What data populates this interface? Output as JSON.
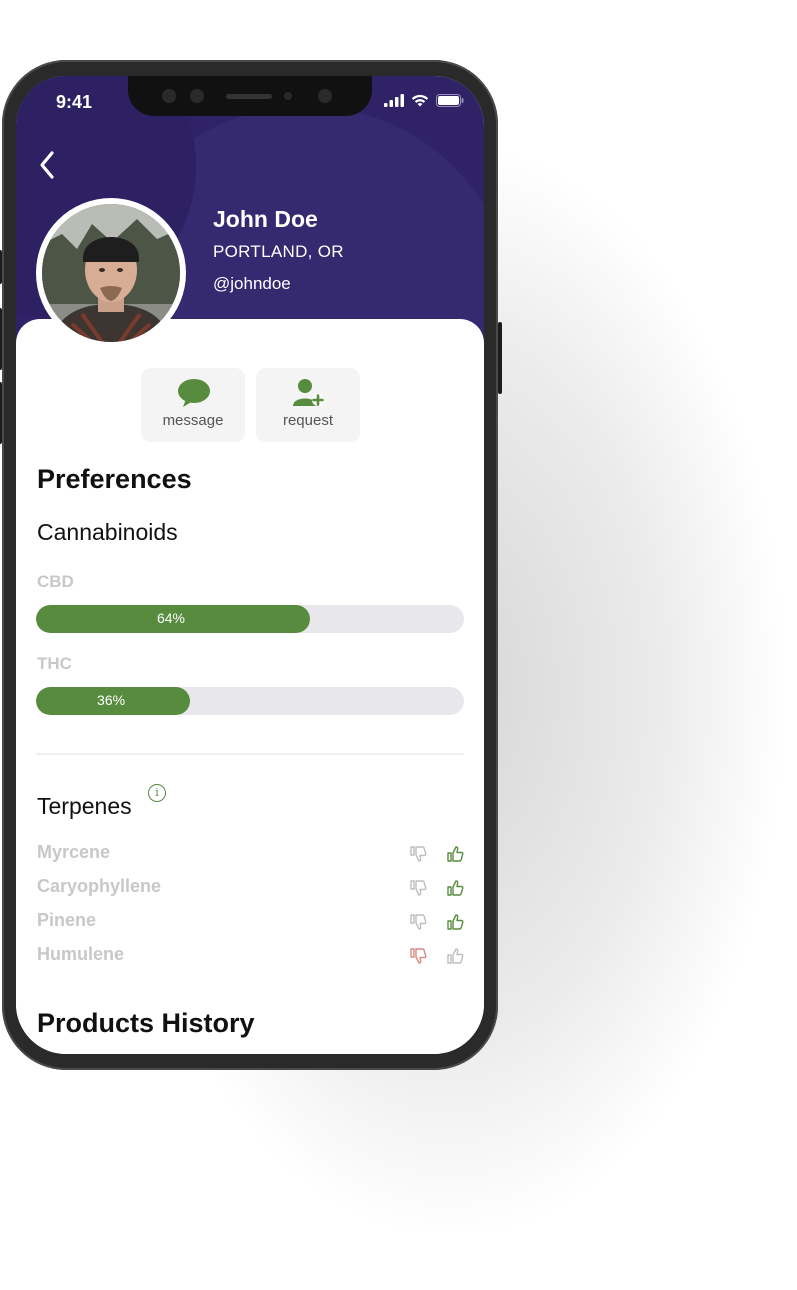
{
  "status_bar": {
    "time": "9:41"
  },
  "profile": {
    "name": "John Doe",
    "location": "PORTLAND, OR",
    "handle": "@johndoe"
  },
  "actions": [
    {
      "label": "message",
      "icon": "chat-bubble-icon"
    },
    {
      "label": "request",
      "icon": "add-user-icon"
    }
  ],
  "preferences": {
    "title": "Preferences",
    "cannabinoids": {
      "title": "Cannabinoids",
      "items": [
        {
          "label": "CBD",
          "value": 64,
          "text": "64%"
        },
        {
          "label": "THC",
          "value": 36,
          "text": "36%"
        }
      ]
    },
    "terpenes": {
      "title": "Terpenes",
      "info_symbol": "i",
      "items": [
        {
          "name": "Myrcene",
          "rating": "like"
        },
        {
          "name": "Caryophyllene",
          "rating": "like"
        },
        {
          "name": "Pinene",
          "rating": "like"
        },
        {
          "name": "Humulene",
          "rating": "dislike"
        }
      ]
    }
  },
  "products_history": {
    "title": "Products History"
  },
  "colors": {
    "header_bg": "#2f2266",
    "accent_green": "#578c3f",
    "dislike_red": "#d98a80",
    "muted_text": "#c8c8c8"
  }
}
